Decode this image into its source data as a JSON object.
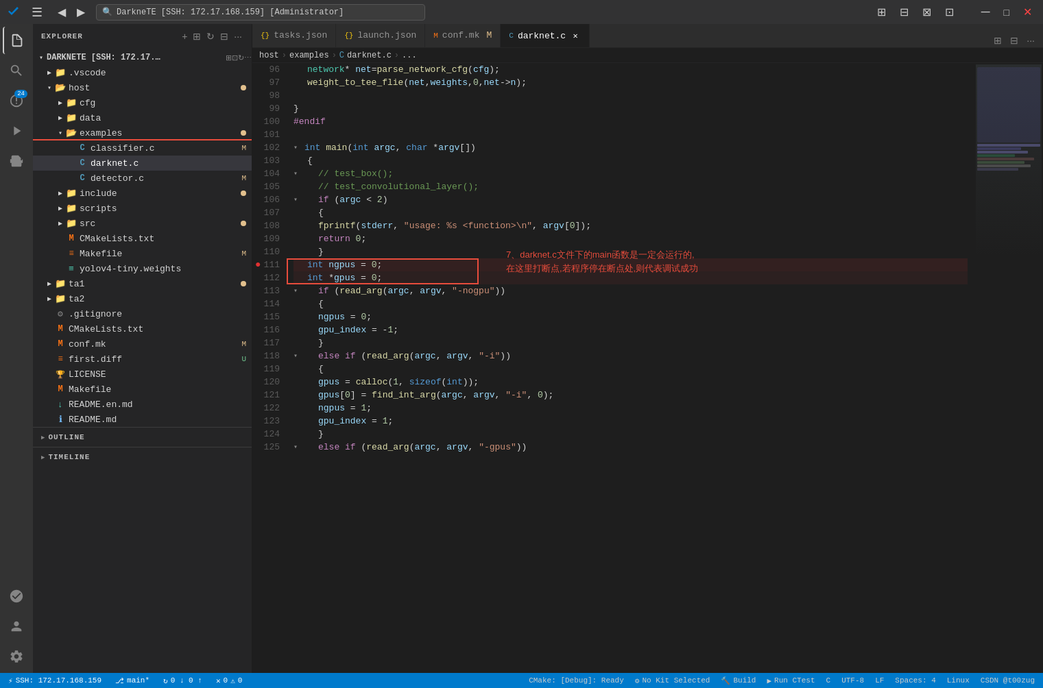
{
  "titlebar": {
    "search_text": "DarkneTE [SSH: 172.17.168.159] [Administrator]",
    "window_controls": [
      "minimize",
      "maximize",
      "close"
    ]
  },
  "tabs": [
    {
      "label": "tasks.json",
      "icon": "{}",
      "active": false,
      "modified": false
    },
    {
      "label": "launch.json",
      "icon": "{}",
      "active": false,
      "modified": false
    },
    {
      "label": "conf.mk",
      "icon": "M",
      "active": false,
      "modified": true
    },
    {
      "label": "darknet.c",
      "icon": "C",
      "active": true,
      "modified": false
    }
  ],
  "breadcrumb": [
    "host",
    "examples",
    "darknet.c",
    "..."
  ],
  "explorer": {
    "header": "EXPLORER",
    "workspace": "DARKNETE [SSH: 172.17...",
    "items": [
      {
        "type": "folder",
        "name": ".vscode",
        "depth": 1,
        "collapsed": true
      },
      {
        "type": "folder",
        "name": "host",
        "depth": 1,
        "collapsed": false
      },
      {
        "type": "folder",
        "name": "cfg",
        "depth": 2,
        "collapsed": true
      },
      {
        "type": "folder",
        "name": "data",
        "depth": 2,
        "collapsed": true
      },
      {
        "type": "folder",
        "name": "examples",
        "depth": 2,
        "collapsed": false,
        "dot": true
      },
      {
        "type": "c-file",
        "name": "classifier.c",
        "depth": 3,
        "badge": "M",
        "selected": false,
        "redbox": true
      },
      {
        "type": "c-file",
        "name": "darknet.c",
        "depth": 3,
        "badge": "",
        "selected": true
      },
      {
        "type": "c-file",
        "name": "detector.c",
        "depth": 3,
        "badge": "M"
      },
      {
        "type": "folder",
        "name": "include",
        "depth": 2,
        "collapsed": true,
        "dot": true
      },
      {
        "type": "folder",
        "name": "scripts",
        "depth": 2,
        "collapsed": true
      },
      {
        "type": "folder",
        "name": "src",
        "depth": 2,
        "collapsed": true,
        "dot": true
      },
      {
        "type": "m-file",
        "name": "CMakeLists.txt",
        "depth": 2
      },
      {
        "type": "makefile",
        "name": "Makefile",
        "depth": 2,
        "badge": "M"
      },
      {
        "type": "weights",
        "name": "yolov4-tiny.weights",
        "depth": 2
      },
      {
        "type": "folder",
        "name": "ta1",
        "depth": 1,
        "collapsed": true,
        "dot": true
      },
      {
        "type": "folder",
        "name": "ta2",
        "depth": 1,
        "collapsed": true
      },
      {
        "type": "gitignore",
        "name": ".gitignore",
        "depth": 1
      },
      {
        "type": "m-file",
        "name": "CMakeLists.txt",
        "depth": 1
      },
      {
        "type": "mk-file",
        "name": "conf.mk",
        "depth": 1,
        "badge": "M"
      },
      {
        "type": "diff",
        "name": "first.diff",
        "depth": 1,
        "badge": "U"
      },
      {
        "type": "license",
        "name": "LICENSE",
        "depth": 1
      },
      {
        "type": "makefile2",
        "name": "Makefile",
        "depth": 1
      },
      {
        "type": "readme-en",
        "name": "README.en.md",
        "depth": 1
      },
      {
        "type": "readme",
        "name": "README.md",
        "depth": 1
      }
    ]
  },
  "outline": "OUTLINE",
  "timeline": "TIMELINE",
  "code": {
    "lines": [
      {
        "num": 96,
        "content": "    network* net=parse_network_cfg(cfg);"
      },
      {
        "num": 97,
        "content": "    weight_to_tee_flie(net,weights,0,net->n);"
      },
      {
        "num": 98,
        "content": ""
      },
      {
        "num": 99,
        "content": "}"
      },
      {
        "num": 100,
        "content": "#endif"
      },
      {
        "num": 101,
        "content": ""
      },
      {
        "num": 102,
        "content": "int main(int argc, char *argv[])",
        "arrow": true
      },
      {
        "num": 103,
        "content": "{"
      },
      {
        "num": 104,
        "content": "    // test_box();",
        "arrow": true
      },
      {
        "num": 105,
        "content": "    // test_convolutional_layer();"
      },
      {
        "num": 106,
        "content": "    if (argc < 2)",
        "arrow": true
      },
      {
        "num": 107,
        "content": "    {"
      },
      {
        "num": 108,
        "content": "        fprintf(stderr, \"usage: %s <function>\\n\", argv[0]);"
      },
      {
        "num": 109,
        "content": "        return 0;"
      },
      {
        "num": 110,
        "content": "    }"
      },
      {
        "num": 111,
        "content": "    int ngpus = 0;",
        "breakpoint": true
      },
      {
        "num": 112,
        "content": "    int *gpus = 0;"
      },
      {
        "num": 113,
        "content": "    if (read_arg(argc, argv, \"-nogpu\"))",
        "arrow": true
      },
      {
        "num": 114,
        "content": "    {"
      },
      {
        "num": 115,
        "content": "        ngpus = 0;"
      },
      {
        "num": 116,
        "content": "        gpu_index = -1;"
      },
      {
        "num": 117,
        "content": "    }"
      },
      {
        "num": 118,
        "content": "    else if (read_arg(argc, argv, \"-i\"))",
        "arrow": true
      },
      {
        "num": 119,
        "content": "    {"
      },
      {
        "num": 120,
        "content": "        gpus = calloc(1, sizeof(int));"
      },
      {
        "num": 121,
        "content": "        gpus[0] = find_int_arg(argc, argv, \"-i\", 0);"
      },
      {
        "num": 122,
        "content": "        ngpus = 1;"
      },
      {
        "num": 123,
        "content": "        gpu_index = 1;"
      },
      {
        "num": 124,
        "content": "    }"
      },
      {
        "num": 125,
        "content": "    else if (read_arg(argc, argv, \"-gpus\"))",
        "arrow": true
      }
    ]
  },
  "annotation": {
    "line1": "7、darknet.c文件下的main函数是一定会运行的,",
    "line2": "在这里打断点,若程序停在断点处,则代表调试成功"
  },
  "status_bar": {
    "ssh": "SSH: 172.17.168.159",
    "branch": "main*",
    "sync": "0 ↓ 0 ↑",
    "errors": "0",
    "warnings": "0",
    "cmake": "CMake: [Debug]: Ready",
    "kit": "No Kit Selected",
    "build": "Build",
    "run": "Run CTest",
    "language": "C",
    "encoding": "UTF-8",
    "eol": "LF",
    "spaces": "Spaces: 4",
    "linux": "Linux",
    "csdn": "CSDN @t00zug"
  }
}
